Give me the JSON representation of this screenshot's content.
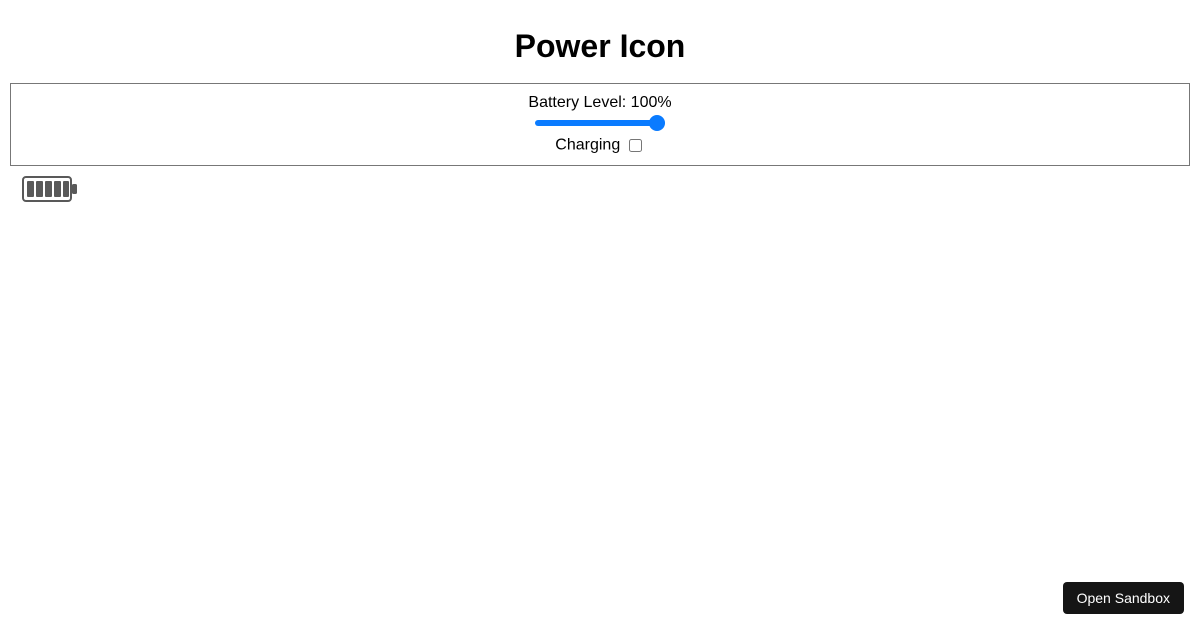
{
  "title": "Power Icon",
  "controls": {
    "battery_label_prefix": "Battery Level: ",
    "battery_level_display": "100%",
    "battery_value": "100",
    "battery_min": "0",
    "battery_max": "100",
    "charging_label": "Charging",
    "charging_checked": false
  },
  "icon": {
    "bars": 5,
    "color": "#595959"
  },
  "sandbox": {
    "button_label": "Open Sandbox"
  }
}
